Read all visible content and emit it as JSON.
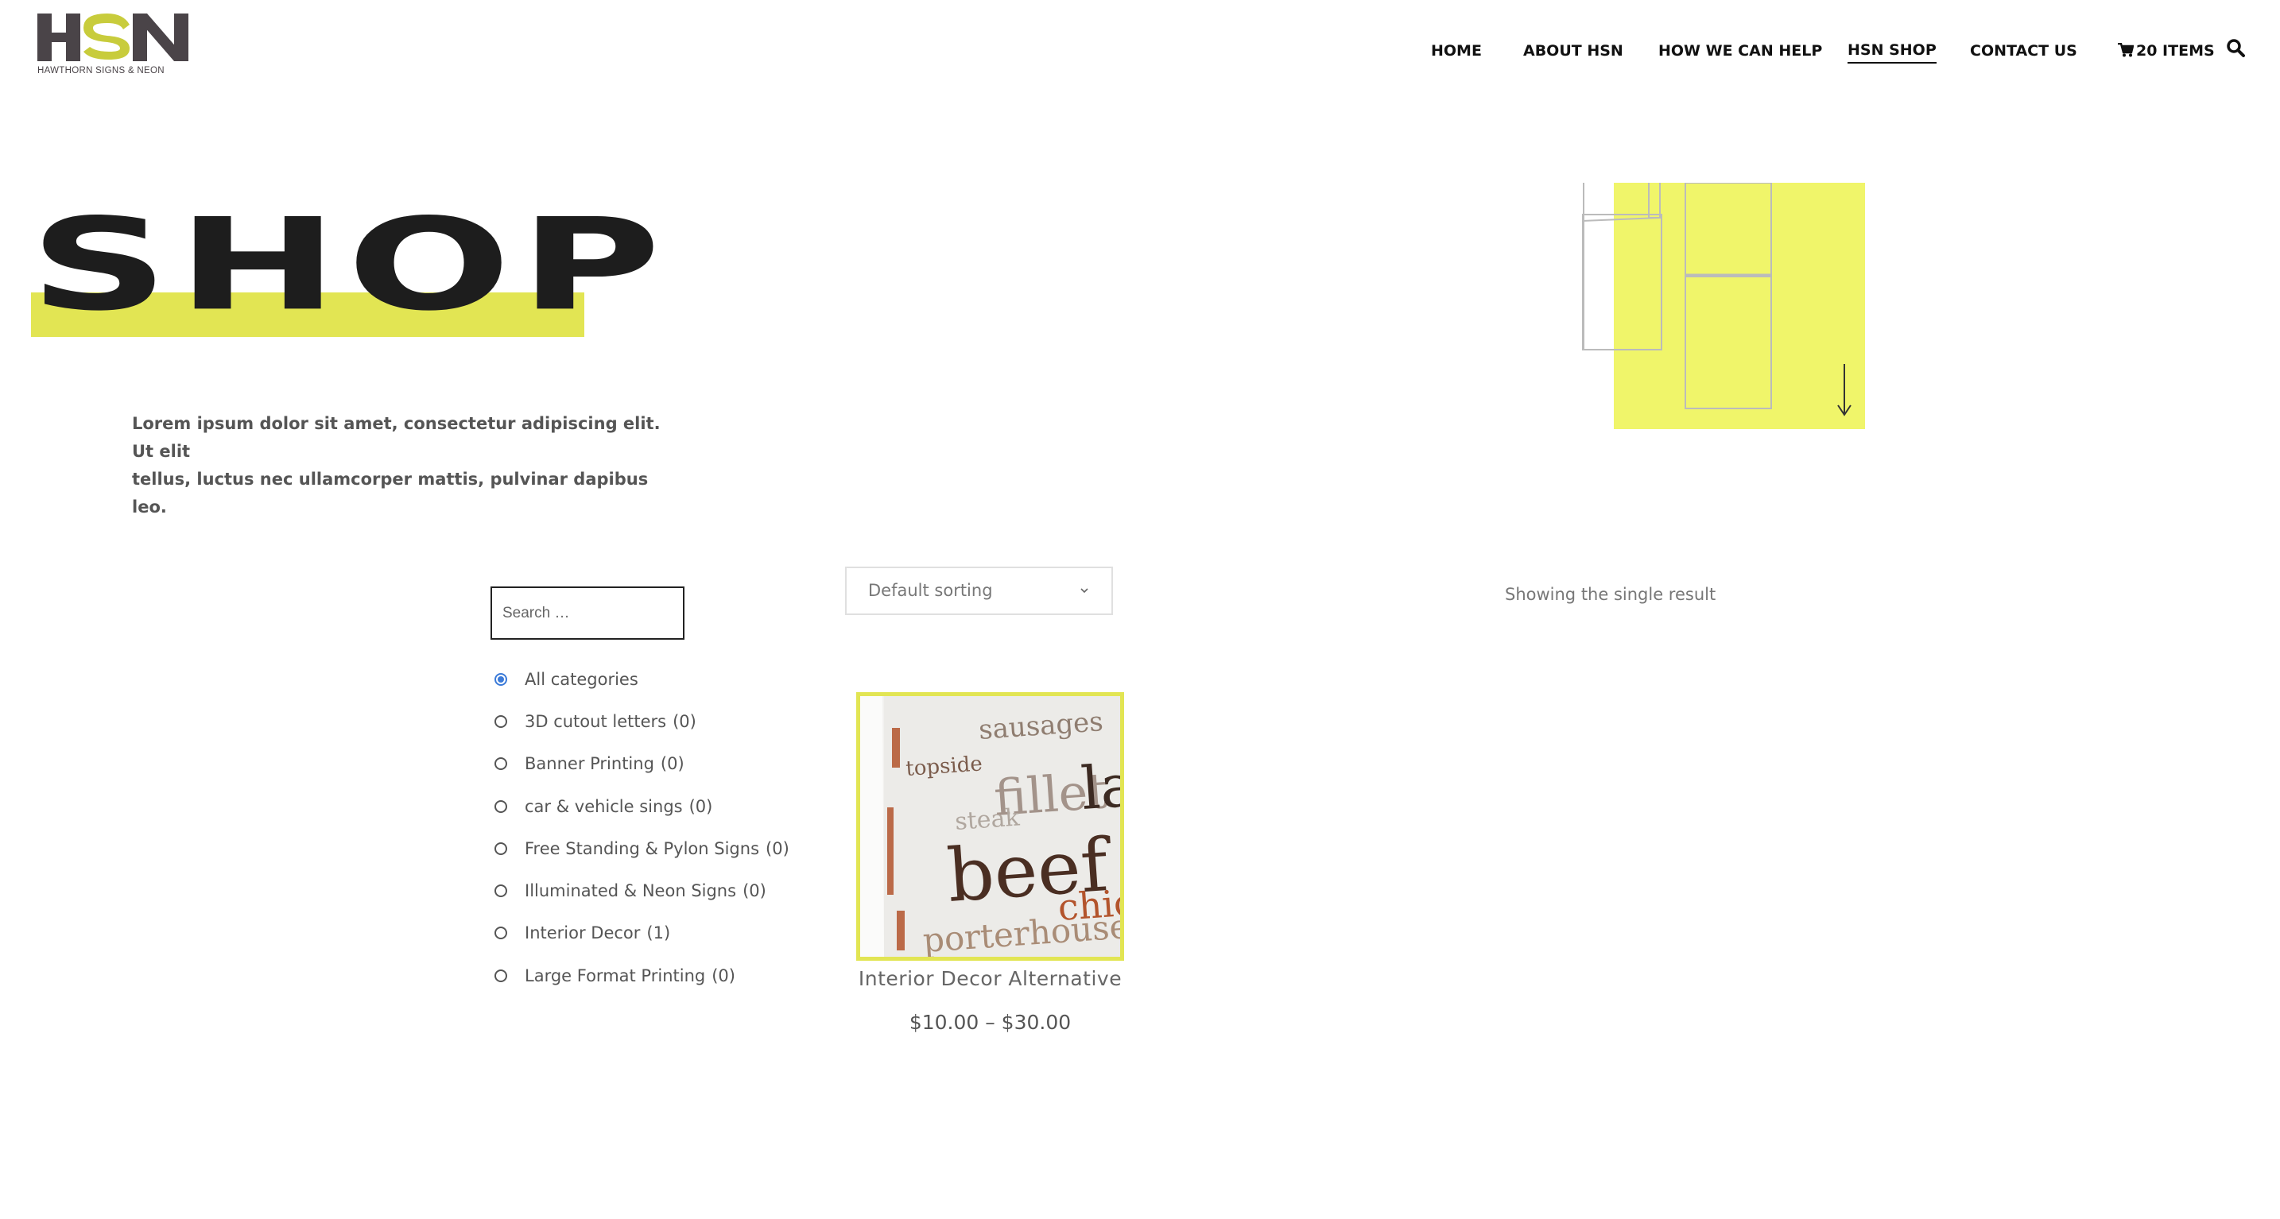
{
  "header": {
    "logo_text": "HSN",
    "logo_subtitle": "HAWTHORN SIGNS & NEON",
    "nav": [
      {
        "label": "HOME"
      },
      {
        "label": "ABOUT HSN"
      },
      {
        "label": "HOW WE CAN HELP"
      },
      {
        "label": "HSN SHOP",
        "active": true
      },
      {
        "label": "CONTACT US"
      }
    ],
    "cart_label": "20 ITEMS",
    "cart_icon": "cart-icon",
    "search_icon": "search-icon"
  },
  "hero": {
    "title": "SHOP",
    "intro_line1": "Lorem ipsum dolor sit amet, consectetur adipiscing elit. Ut elit",
    "intro_line2": "tellus, luctus nec ullamcorper mattis, pulvinar dapibus leo.",
    "accent_color": "#e2e553",
    "art_color": "#f0f56a"
  },
  "sidebar": {
    "search_placeholder": "Search …",
    "categories": [
      {
        "label": "All categories",
        "count": "",
        "checked": true
      },
      {
        "label": "3D cutout letters",
        "count": "(0)"
      },
      {
        "label": "Banner Printing",
        "count": "(0)"
      },
      {
        "label": "car & vehicle sings",
        "count": "(0)"
      },
      {
        "label": "Free Standing & Pylon Signs",
        "count": "(0)"
      },
      {
        "label": "Illuminated & Neon Signs",
        "count": "(0)"
      },
      {
        "label": "Interior Decor",
        "count": "(1)"
      },
      {
        "label": "Large Format Printing",
        "count": "(0)"
      }
    ]
  },
  "shop": {
    "sort_selected": "Default sorting",
    "result_text": "Showing the single result",
    "products": [
      {
        "title": "Interior Decor Alternative",
        "price": "$10.00 – $30.00",
        "image_words": [
          "sausages",
          "topside",
          "fillet",
          "steak",
          "beef",
          "chick",
          "porterhouse",
          "lam"
        ]
      }
    ]
  }
}
